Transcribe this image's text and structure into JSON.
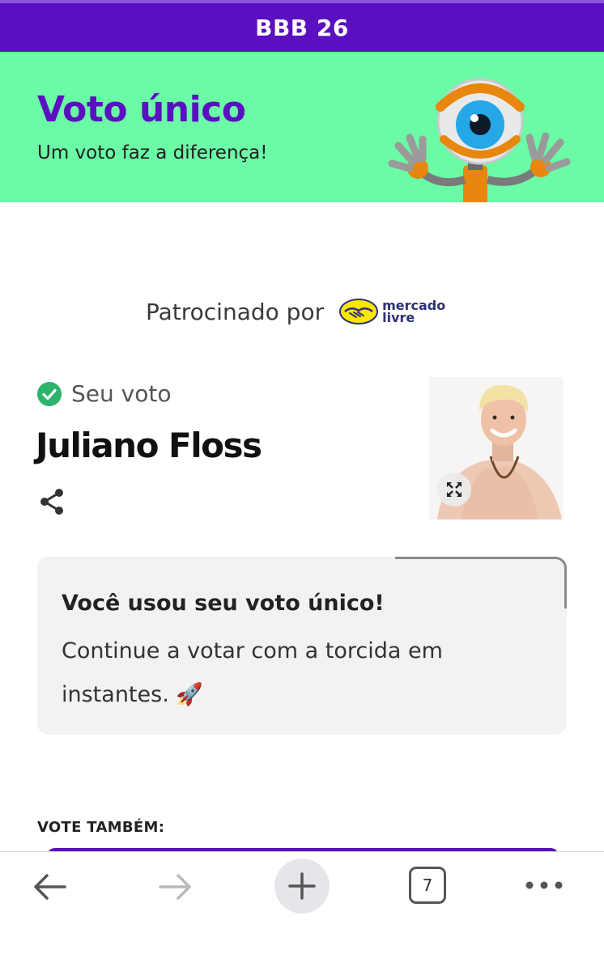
{
  "app_bar": {
    "title": "BBB 26"
  },
  "hero": {
    "title": "Voto único",
    "subtitle": "Um voto faz a diferença!",
    "mascot_icon": "big-brother-eye-mascot"
  },
  "sponsor": {
    "label": "Patrocinado por",
    "brand_line1": "mercado",
    "brand_line2": "livre"
  },
  "vote": {
    "label": "Seu voto",
    "candidate": "Juliano Floss"
  },
  "notice": {
    "title": "Você usou seu voto único!",
    "body": "Continue a votar com a torcida em instantes. 🚀"
  },
  "also_vote": {
    "label": "VOTE TAMBÉM:"
  },
  "browser_nav": {
    "tab_count": "7"
  },
  "colors": {
    "brand_purple": "#5a0fc0",
    "hero_green": "#6bfaa6",
    "check_green": "#2db36b"
  }
}
